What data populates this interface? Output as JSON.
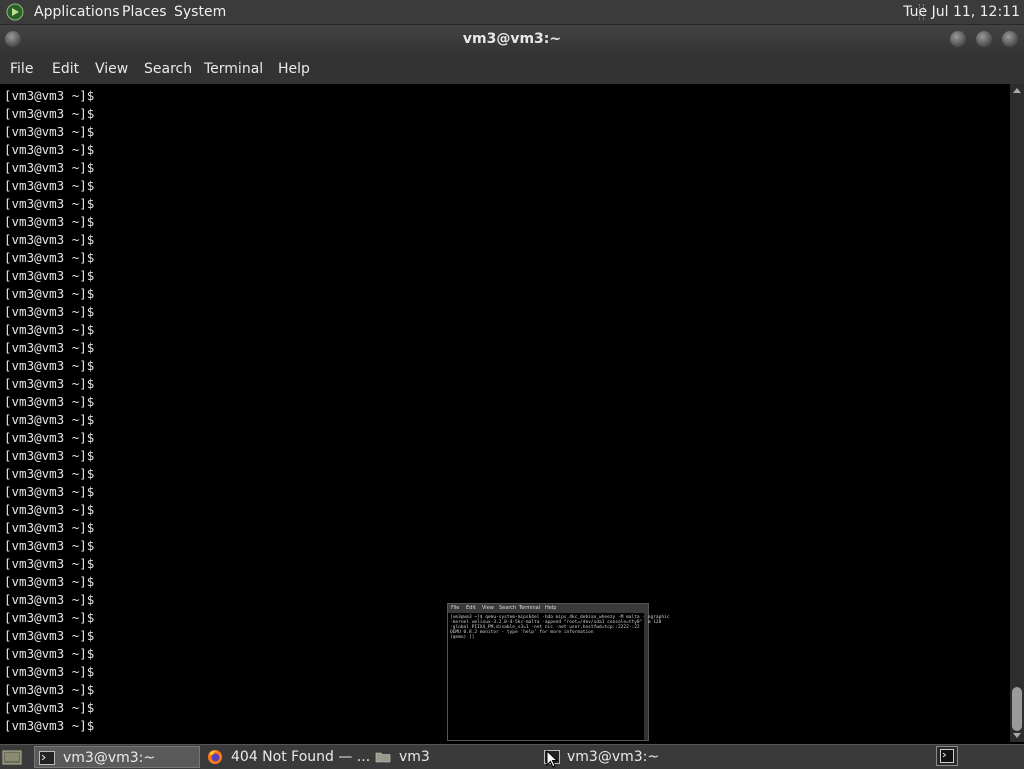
{
  "top_panel": {
    "menus": [
      "Applications",
      "Places",
      "System"
    ],
    "clock": "Tue Jul 11, 12:11"
  },
  "window": {
    "title": "vm3@vm3:~"
  },
  "menubar": {
    "items": [
      "File",
      "Edit",
      "View",
      "Search",
      "Terminal",
      "Help"
    ]
  },
  "terminal": {
    "prompt": "[vm3@vm3 ~]$"
  },
  "preview": {
    "menus": [
      "File",
      "Edit",
      "View",
      "Search",
      "Terminal",
      "Help"
    ],
    "lines": [
      "[vm3@vm3 ~]$ qemu-system-mips64el -hda mips_4kc_debian_wheezy -M malta -nographic",
      "-kernel vmlinux-3.2.0-4-5kc-malta -append \"root=/dev/sda1 console=tty0\" -m 128",
      "-global PIIX4_PM.disable_s3=1 -net nic -net user,hostfwd=tcp::2222-:22",
      "QEMU 0.8.2 monitor - type 'help' for more information",
      "(qemu) []"
    ]
  },
  "taskbar": {
    "tasks": [
      {
        "label": "vm3@vm3:~",
        "icon": "terminal-icon"
      },
      {
        "label": "404 Not Found — ...",
        "icon": "firefox-icon"
      },
      {
        "label": "vm3",
        "icon": "folder-icon"
      },
      {
        "label": "vm3@vm3:~",
        "icon": "terminal-icon"
      }
    ]
  },
  "colors": {
    "panel": "#3b3b3b",
    "terminal_bg": "#000000",
    "terminal_fg": "#e6e6e6"
  }
}
